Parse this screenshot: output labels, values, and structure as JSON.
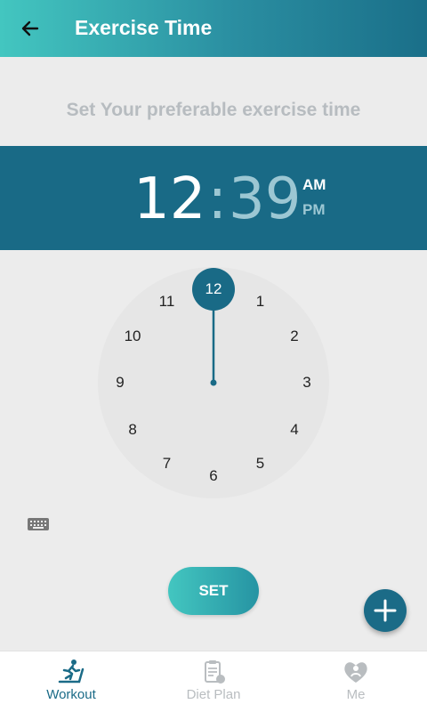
{
  "appbar": {
    "title": "Exercise Time",
    "back_icon": "arrow-left-icon"
  },
  "subtitle": "Set Your preferable exercise time",
  "time_picker": {
    "hour": "12",
    "separator": ":",
    "minute": "39",
    "am_label": "AM",
    "pm_label": "PM",
    "selected_period": "AM",
    "accent_color": "#196a86"
  },
  "clock_face": {
    "selected": "12",
    "numbers": [
      "12",
      "1",
      "2",
      "3",
      "4",
      "5",
      "6",
      "7",
      "8",
      "9",
      "10",
      "11"
    ]
  },
  "keyboard_toggle_icon": "keyboard-icon",
  "set_button": {
    "label": "SET"
  },
  "fab_icon": "plus-icon",
  "bottom_nav": {
    "items": [
      {
        "label": "Workout",
        "icon": "treadmill-runner-icon",
        "active": true
      },
      {
        "label": "Diet Plan",
        "icon": "diet-clipboard-icon",
        "active": false
      },
      {
        "label": "Me",
        "icon": "heart-person-icon",
        "active": false
      }
    ]
  }
}
